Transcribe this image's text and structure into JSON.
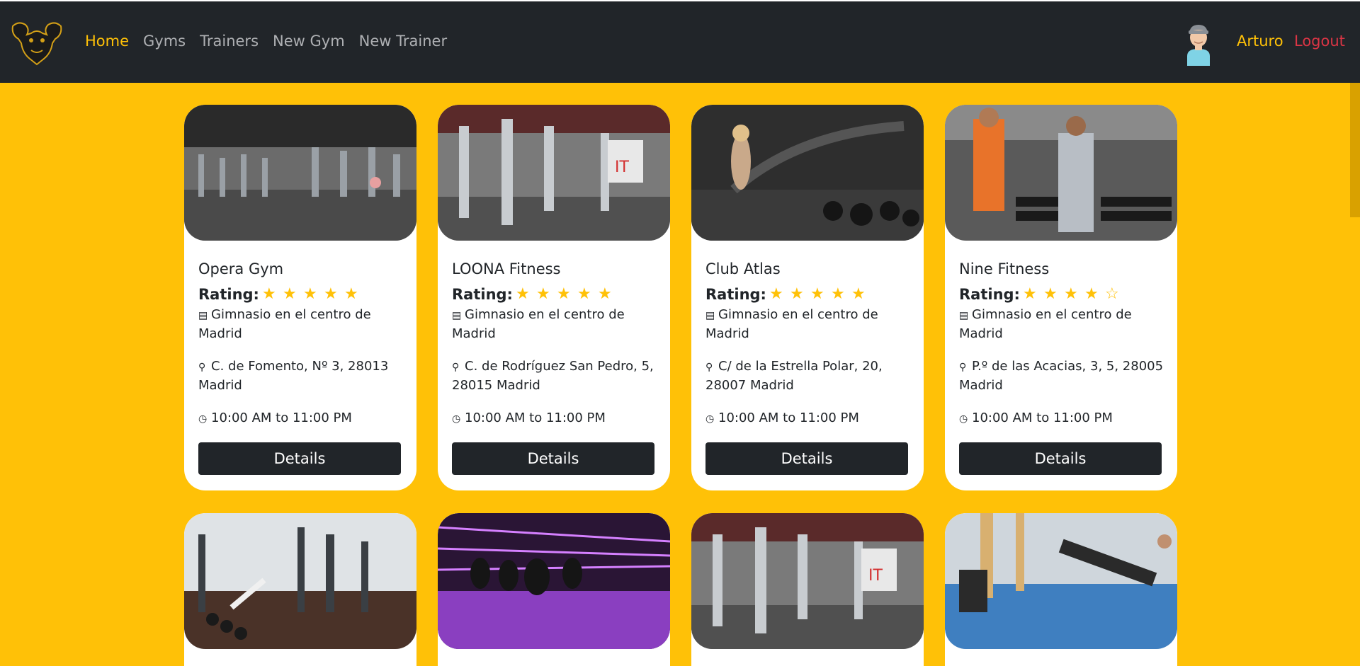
{
  "navbar": {
    "logo_icon": "muscle-bull-logo-icon",
    "links": [
      {
        "label": "Home",
        "active": true
      },
      {
        "label": "Gyms",
        "active": false
      },
      {
        "label": "Trainers",
        "active": false
      },
      {
        "label": "New Gym",
        "active": false
      },
      {
        "label": "New Trainer",
        "active": false
      }
    ],
    "avatar_icon": "user-avatar-icon",
    "user_name": "Arturo",
    "logout_label": "Logout"
  },
  "colors": {
    "accent": "#ffc107",
    "dark": "#212529",
    "danger": "#dc3545",
    "card": "#ffffff"
  },
  "gyms": [
    {
      "name": "Opera Gym",
      "rating_label": "Rating:",
      "rating": 5,
      "description": "Gimnasio en el centro de Madrid",
      "address": "C. de Fomento, Nº 3, 28013 Madrid",
      "hours": "10:00 AM to 11:00 PM",
      "button": "Details",
      "image": "gym-floor-photo"
    },
    {
      "name": "LOONA Fitness",
      "rating_label": "Rating:",
      "rating": 5,
      "description": "Gimnasio en el centro de Madrid",
      "address": "C. de Rodríguez San Pedro, 5, 28015 Madrid",
      "hours": "10:00 AM to 11:00 PM",
      "button": "Details",
      "image": "gym-machines-photo"
    },
    {
      "name": "Club Atlas",
      "rating_label": "Rating:",
      "rating": 5,
      "description": "Gimnasio en el centro de Madrid",
      "address": "C/ de la Estrella Polar, 20, 28007 Madrid",
      "hours": "10:00 AM to 11:00 PM",
      "button": "Details",
      "image": "battle-ropes-photo"
    },
    {
      "name": "Nine Fitness",
      "rating_label": "Rating:",
      "rating": 4,
      "description": "Gimnasio en el centro de Madrid",
      "address": "P.º de las Acacias, 3, 5, 28005 Madrid",
      "hours": "10:00 AM to 11:00 PM",
      "button": "Details",
      "image": "dumbbell-rack-photo"
    },
    {
      "image": "weights-room-photo"
    },
    {
      "image": "boxing-bags-purple-photo"
    },
    {
      "image": "gym-machines-photo"
    },
    {
      "image": "treadmill-room-photo"
    }
  ],
  "icons": {
    "description": "newspaper-icon",
    "address": "map-marker-icon",
    "hours": "clock-icon",
    "star_full": "star-filled-icon",
    "star_empty": "star-empty-icon"
  }
}
